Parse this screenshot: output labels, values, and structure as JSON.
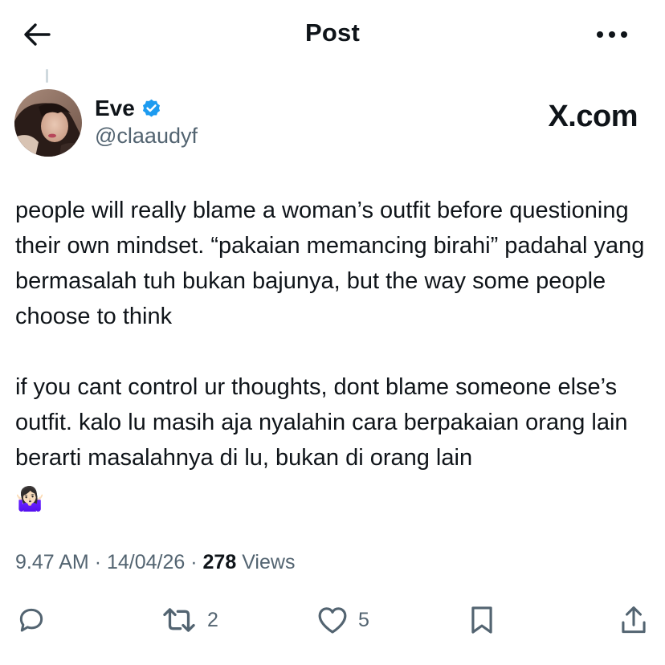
{
  "header": {
    "title": "Post",
    "back_icon": "arrow-left-icon",
    "more_icon": "more-horizontal-icon"
  },
  "author": {
    "name": "Eve",
    "handle": "@claaudyf",
    "verified": true,
    "verified_color": "#1d9bf0"
  },
  "watermark": "X.com",
  "post": {
    "paragraphs": [
      "people will really blame a woman’s outfit before questioning their own mindset. “pakaian memancing birahi” padahal yang bermasalah tuh bukan bajunya, but the way some people choose to think",
      "if you cant control ur thoughts, dont blame someone else’s outfit. kalo lu masih aja nyalahin cara berpakaian orang lain berarti masalahnya di lu, bukan di orang lain"
    ],
    "emoji": "🤷🏻‍♀️"
  },
  "meta": {
    "time": "9.47 AM",
    "separator": "·",
    "date": "14/04/26",
    "views_count": "278",
    "views_label": "Views"
  },
  "actions": {
    "reply": {
      "icon": "reply-icon",
      "count": ""
    },
    "repost": {
      "icon": "repost-icon",
      "count": "2"
    },
    "like": {
      "icon": "heart-icon",
      "count": "5"
    },
    "bookmark": {
      "icon": "bookmark-icon",
      "count": ""
    },
    "share": {
      "icon": "share-icon",
      "count": ""
    }
  },
  "colors": {
    "text": "#0f1419",
    "secondary": "#536471",
    "accent": "#1d9bf0"
  }
}
